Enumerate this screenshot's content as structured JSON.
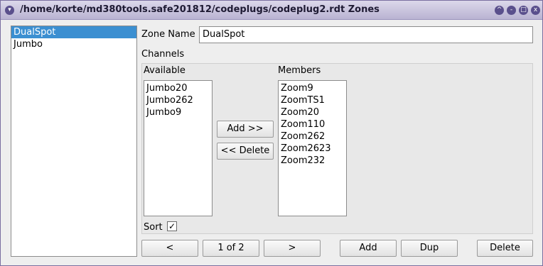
{
  "window": {
    "title": "/home/korte/md380tools.safe201812/codeplugs/codeplug2.rdt Zones",
    "menu_icon": "chevron-down-icon",
    "buttons": [
      "^",
      "-",
      "□",
      "x"
    ]
  },
  "zones": {
    "items": [
      {
        "label": "DualSpot",
        "selected": true
      },
      {
        "label": "Jumbo",
        "selected": false
      }
    ]
  },
  "form": {
    "zone_name_label": "Zone Name",
    "zone_name_value": "DualSpot",
    "channels_label": "Channels",
    "available_label": "Available",
    "members_label": "Members",
    "available": [
      "Jumbo20",
      "Jumbo262",
      "Jumbo9"
    ],
    "members": [
      "Zoom9",
      "ZoomTS1",
      "Zoom20",
      "Zoom110",
      "Zoom262",
      "Zoom2623",
      "Zoom232"
    ],
    "add_button": "Add >>",
    "delete_button": "<< Delete",
    "sort_label": "Sort",
    "sort_checked": true,
    "check_mark": "✓"
  },
  "footer": {
    "prev": "<",
    "page": "1 of 2",
    "next": ">",
    "add": "Add",
    "dup": "Dup",
    "delete": "Delete"
  },
  "colors": {
    "selection": "#3b8fd1",
    "titlebar": "#b9b3d2",
    "window_bg": "#eeeeee"
  }
}
